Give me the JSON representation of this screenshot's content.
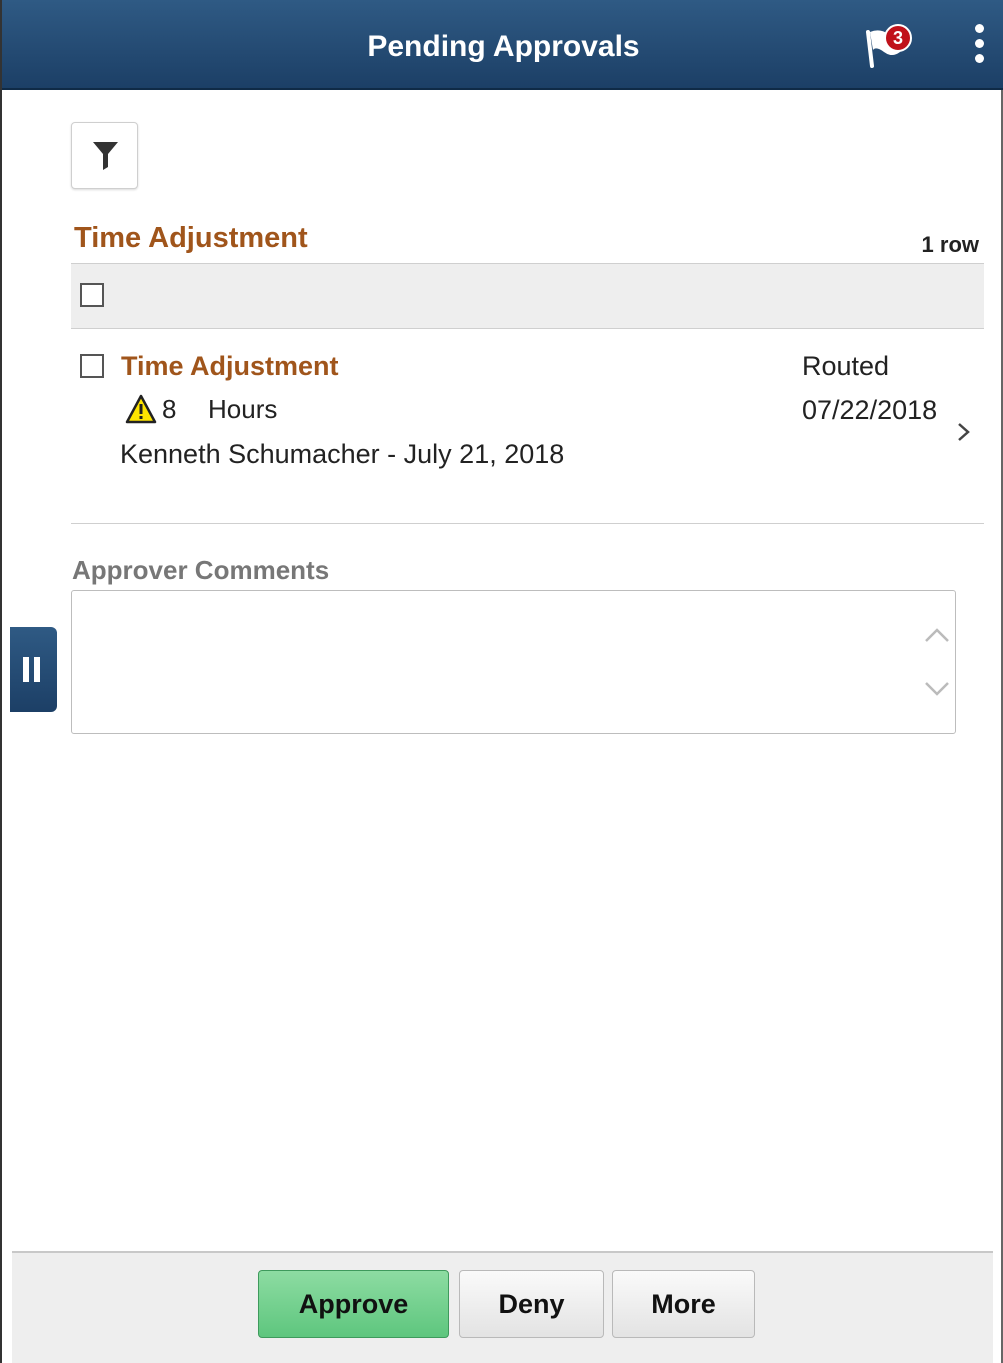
{
  "header": {
    "title": "Pending Approvals",
    "notification_count": "3"
  },
  "list": {
    "section_title": "Time Adjustment",
    "row_count": "1 row",
    "items": [
      {
        "title": "Time Adjustment",
        "hours_value": "8",
        "hours_unit": "Hours",
        "employee_line": "Kenneth Schumacher - July 21, 2018",
        "status": "Routed",
        "status_date": "07/22/2018"
      }
    ]
  },
  "comments": {
    "label": "Approver Comments",
    "value": ""
  },
  "footer": {
    "approve_label": "Approve",
    "deny_label": "Deny",
    "more_label": "More"
  },
  "colors": {
    "header_bg": "#1c3f66",
    "link_title": "#a0551b",
    "approve_bg": "#5ec67e",
    "badge": "#c0111a"
  },
  "icons": [
    "flag-icon",
    "kebab-menu-icon",
    "filter-icon",
    "warning-icon",
    "chevron-right-icon",
    "scroll-up-icon",
    "scroll-down-icon",
    "pause-icon"
  ]
}
